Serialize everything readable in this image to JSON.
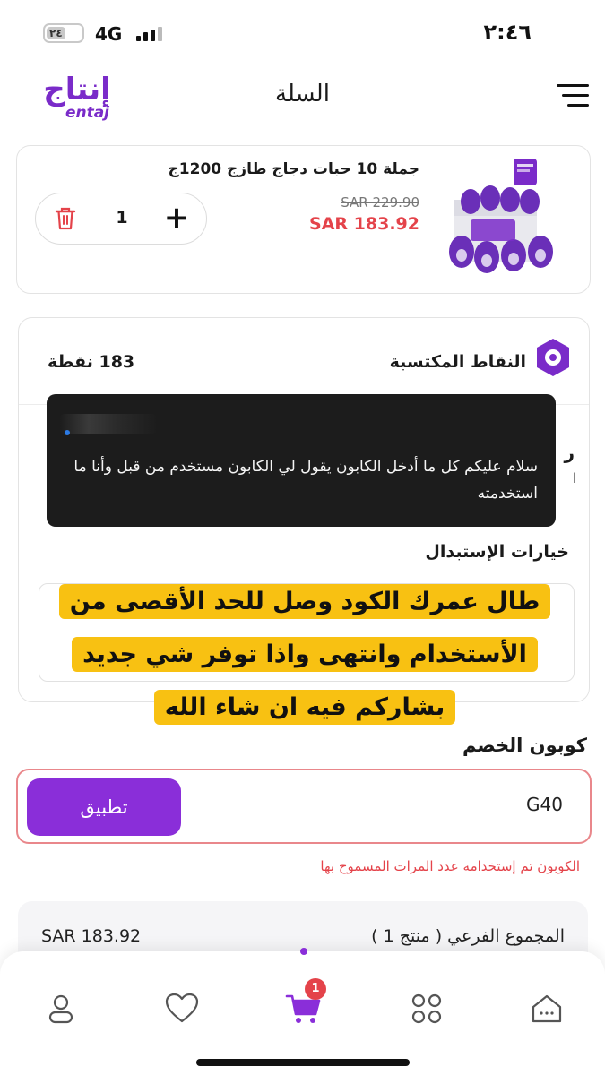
{
  "status_bar": {
    "battery": "٢٤",
    "network": "4G",
    "time": "٢:٤٦"
  },
  "header": {
    "logo_ar": "إنتاج",
    "logo_en": "entaj",
    "title": "السلة"
  },
  "cart_item": {
    "name": "جملة 10 حبات دجاج طازج 1200ج",
    "old_price": "SAR 229.90",
    "new_price": "SAR 183.92",
    "quantity": "1"
  },
  "points": {
    "label": "النقاط المكتسبة",
    "value": "183 نقطة",
    "replacement_label": "خيارات الإستبدال"
  },
  "chat": {
    "message": "سلام عليكم كل ما أدخل الكابون يقول لي الكابون مستخدم من قبل وأنا ما استخدمته"
  },
  "reply": {
    "text": "طال عمرك الكود وصل للحد الأقصى من الأستخدام وانتهى واذا توفر شي جديد بشاركم فيه ان شاء الله"
  },
  "coupon": {
    "title": "كوبون الخصم",
    "value": "G40",
    "apply_label": "تطبيق",
    "error": "الكوبون تم إستخدامه عدد المرات المسموح بها"
  },
  "summary": {
    "subtotal_label": "المجموع الفرعي ( منتج 1 )",
    "subtotal_value": "SAR 183.92"
  },
  "bottom_nav": {
    "cart_badge": "1",
    "items": [
      "home-icon",
      "categories-icon",
      "cart-icon",
      "heart-icon",
      "profile-icon"
    ],
    "active_color": "#8a2ed9"
  },
  "colors": {
    "brand": "#7a2bc9",
    "button": "#8a2ed9",
    "price": "#e4434a",
    "highlight": "#f8c112"
  }
}
